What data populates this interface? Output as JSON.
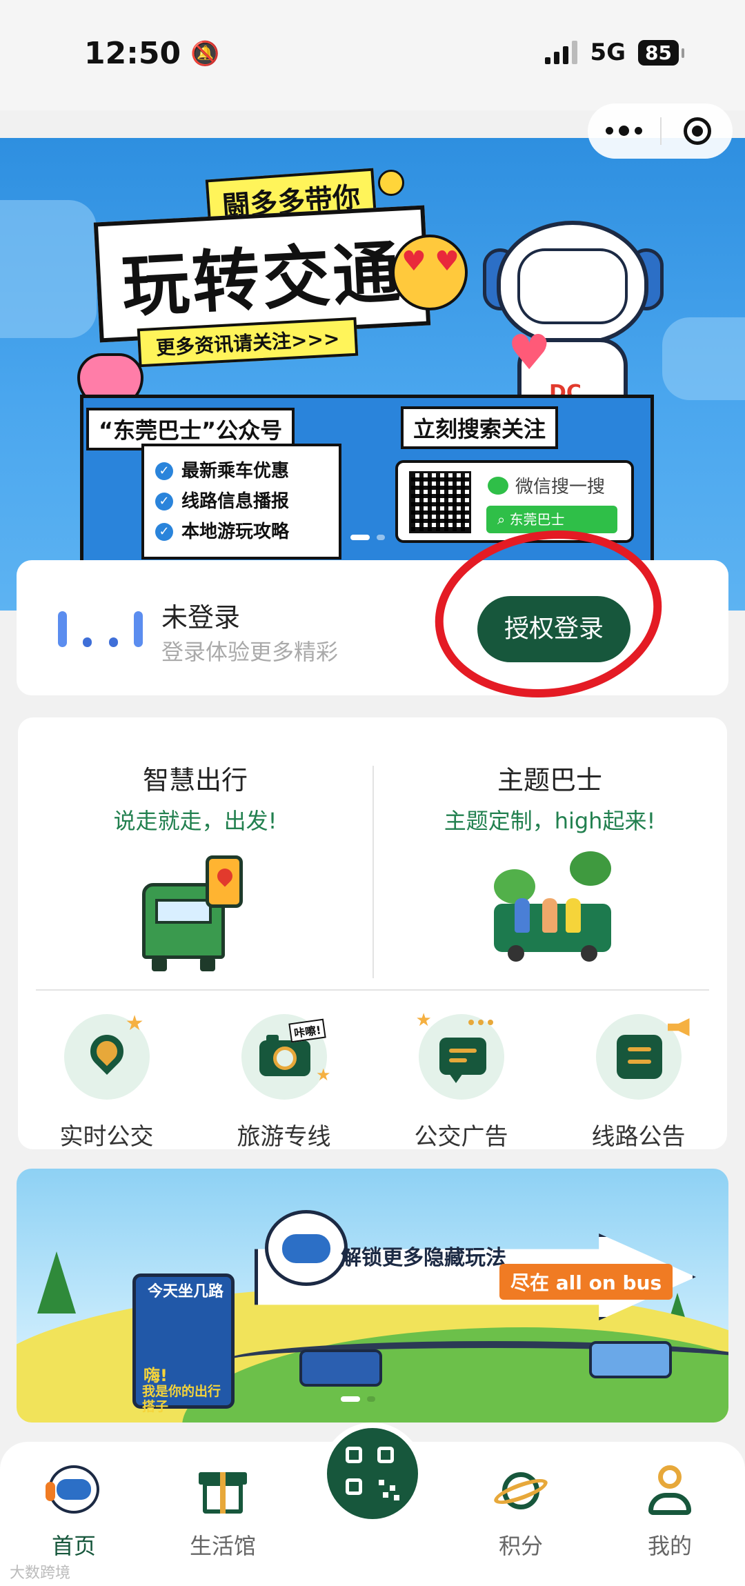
{
  "status_bar": {
    "time": "12:50",
    "network": "5G",
    "battery": "85"
  },
  "top_banner": {
    "subtitle": "闘多多带你",
    "title": "玩转交通",
    "more_info": "更多资讯请关注>>>",
    "account_tag": "“东莞巴士”公众号",
    "search_tag": "立刻搜索关注",
    "benefits": [
      "最新乘车优惠",
      "线路信息播报",
      "本地游玩攻略"
    ],
    "wechat_search": "微信搜一搜",
    "search_term": "东莞巴士",
    "robot_badge": "DC"
  },
  "login": {
    "title": "未登录",
    "subtitle": "登录体验更多精彩",
    "button": "授权登录"
  },
  "services": {
    "left": {
      "title": "智慧出行",
      "subtitle": "说走就走，出发!"
    },
    "right": {
      "title": "主题巴士",
      "subtitle": "主题定制，high起来!"
    },
    "icons": [
      {
        "label": "实时公交",
        "icon": "location-pin-icon"
      },
      {
        "label": "旅游专线",
        "icon": "camera-icon",
        "tag": "咔嚓!"
      },
      {
        "label": "公交广告",
        "icon": "chat-icon"
      },
      {
        "label": "线路公告",
        "icon": "announcement-icon"
      }
    ]
  },
  "bottom_banner": {
    "main_text": "解锁更多隐藏玩法",
    "pill": "尽在 all on bus",
    "sign_title": "今天坐几路",
    "sign_text_1": "嗨!",
    "sign_text_2": "我是你的出行搭子"
  },
  "tab_bar": {
    "tabs": [
      {
        "label": "首页",
        "icon": "home-mascot-icon",
        "active": true
      },
      {
        "label": "生活馆",
        "icon": "gift-icon"
      },
      {
        "label": "积分",
        "icon": "planet-icon"
      },
      {
        "label": "我的",
        "icon": "user-icon"
      }
    ],
    "center": "qr-scan-icon"
  },
  "watermark": "大数跨境",
  "colors": {
    "primary": "#17573c",
    "accent": "#e7a83a",
    "annotation_red": "#e41b24",
    "banner_blue": "#2e8fe0"
  }
}
